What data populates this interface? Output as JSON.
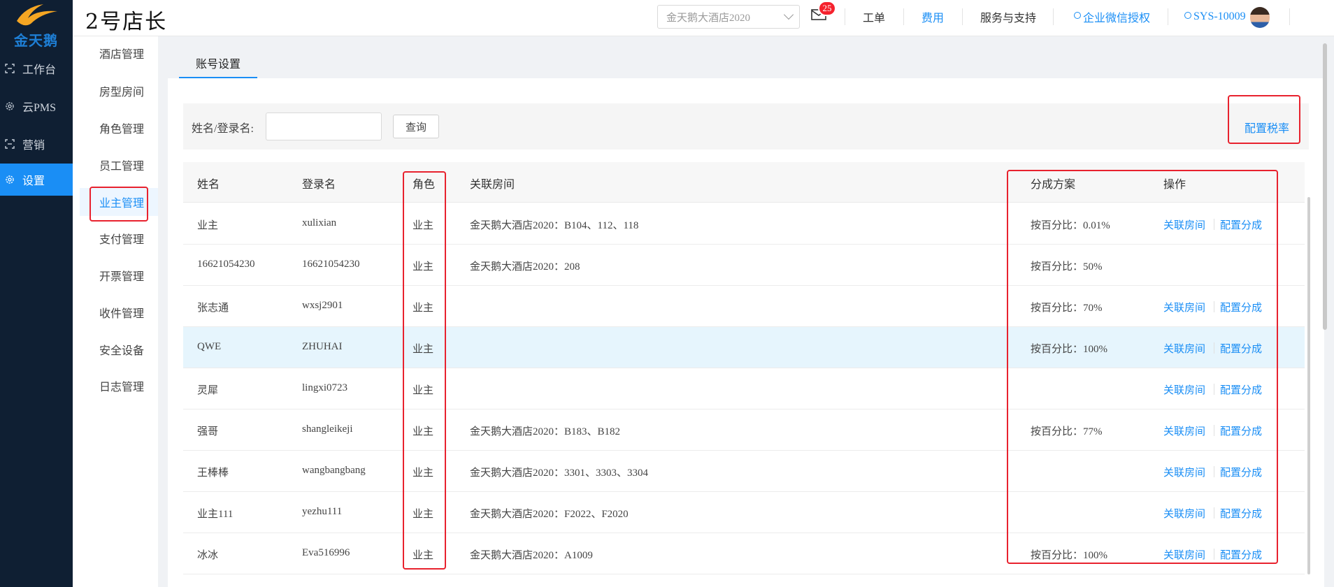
{
  "logo": {
    "text": "金天鹅"
  },
  "leftnav": [
    {
      "label": "工作台",
      "icon": "workbench-icon"
    },
    {
      "label": "云PMS",
      "icon": "gear-icon"
    },
    {
      "label": "营销",
      "icon": "marketing-icon"
    },
    {
      "label": "设置",
      "icon": "settings-icon",
      "active": true
    }
  ],
  "header": {
    "brand": "2号店长",
    "hotel_select": "金天鹅大酒店2020",
    "mail_badge": "25",
    "workorder": "工单",
    "fees": "费用",
    "support": "服务与支持",
    "wechat_auth": "企业微信授权",
    "user": "SYS-10009"
  },
  "submenu": [
    {
      "label": "酒店管理"
    },
    {
      "label": "房型房间"
    },
    {
      "label": "角色管理"
    },
    {
      "label": "员工管理"
    },
    {
      "label": "业主管理",
      "active": true
    },
    {
      "label": "支付管理"
    },
    {
      "label": "开票管理"
    },
    {
      "label": "收件管理"
    },
    {
      "label": "安全设备"
    },
    {
      "label": "日志管理"
    }
  ],
  "tab": "账号设置",
  "search": {
    "label": "姓名/登录名:",
    "value": "",
    "button": "查询",
    "tax_link": "配置税率"
  },
  "table": {
    "headers": {
      "name": "姓名",
      "login": "登录名",
      "role": "角色",
      "rooms": "关联房间",
      "plan": "分成方案",
      "ops": "操作"
    },
    "op_link_room": "关联房间",
    "op_config_share": "配置分成",
    "rows": [
      {
        "name": "业主",
        "login": "xulixian",
        "role": "业主",
        "rooms": "金天鹅大酒店2020：B104、112、118",
        "plan": "按百分比：0.01%",
        "ops": true
      },
      {
        "name": "16621054230",
        "login": "16621054230",
        "role": "业主",
        "rooms": "金天鹅大酒店2020：208",
        "plan": "按百分比：50%",
        "ops": false
      },
      {
        "name": "张志通",
        "login": "wxsj2901",
        "role": "业主",
        "rooms": "",
        "plan": "按百分比：70%",
        "ops": true
      },
      {
        "name": "QWE",
        "login": "ZHUHAI",
        "role": "业主",
        "rooms": "",
        "plan": "按百分比：100%",
        "ops": true,
        "highlight": true
      },
      {
        "name": "灵犀",
        "login": "lingxi0723",
        "role": "业主",
        "rooms": "",
        "plan": "",
        "ops": true
      },
      {
        "name": "强哥",
        "login": "shangleikeji",
        "role": "业主",
        "rooms": "金天鹅大酒店2020：B183、B182",
        "plan": "按百分比：77%",
        "ops": true
      },
      {
        "name": "王棒棒",
        "login": "wangbangbang",
        "role": "业主",
        "rooms": "金天鹅大酒店2020：3301、3303、3304",
        "plan": "",
        "ops": true
      },
      {
        "name": "业主111",
        "login": "yezhu111",
        "role": "业主",
        "rooms": "金天鹅大酒店2020：F2022、F2020",
        "plan": "",
        "ops": true
      },
      {
        "name": "冰冰",
        "login": "Eva516996",
        "role": "业主",
        "rooms": "金天鹅大酒店2020：A1009",
        "plan": "按百分比：100%",
        "ops": true
      }
    ]
  },
  "colors": {
    "accent": "#1a8ef5",
    "nav_bg": "#0f1f33",
    "highlight_box": "#e8222e"
  }
}
